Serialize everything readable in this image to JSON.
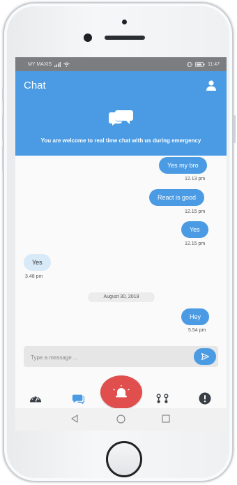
{
  "status_bar": {
    "carrier": "MY MAXIS",
    "time": "11:47"
  },
  "header": {
    "title": "Chat",
    "profile_icon": "user-icon"
  },
  "banner": {
    "icon": "chat-bubbles-icon",
    "message": "You are welcome to real time chat with us during emergency"
  },
  "messages": [
    {
      "direction": "out",
      "text": "Yes my bro",
      "time": "12.13 pm"
    },
    {
      "direction": "out",
      "text": "React is good",
      "time": "12.15 pm"
    },
    {
      "direction": "out",
      "text": "Yes",
      "time": "12.15 pm"
    },
    {
      "direction": "in",
      "text": "Yes",
      "time": "3.48 pm"
    },
    {
      "direction": "out",
      "text": "Hey",
      "time": "5.54 pm"
    }
  ],
  "date_separator": "August 30, 2019",
  "composer": {
    "placeholder": "Type a message ...",
    "send_icon": "send-icon"
  },
  "bottom_nav": {
    "items": [
      "dashboard-icon",
      "chat-icon",
      "alarm-bell-icon",
      "route-icon",
      "alert-icon"
    ]
  },
  "colors": {
    "primary": "#4a9be3",
    "alarm": "#e04e4e",
    "incoming_bubble": "#d8e9f7"
  }
}
